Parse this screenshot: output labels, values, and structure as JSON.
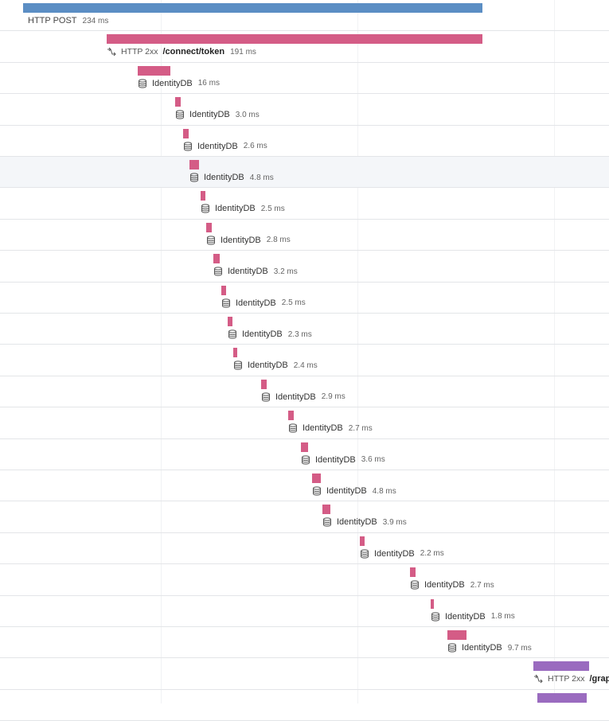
{
  "colors": {
    "root_bar": "#5b8ec4",
    "db_bar": "#d45c86",
    "http_bar": "#d45c86",
    "graph_bar": "#9a6bbf"
  },
  "spans": [
    {
      "kind": "",
      "name": "HTTP POST",
      "duration": "234 ms",
      "icon": "none",
      "color": "#5b8ec4",
      "bold": false
    },
    {
      "kind": "HTTP 2xx",
      "name": "/connect/token",
      "duration": "191 ms",
      "icon": "http-arrow-icon",
      "color": "#d45c86",
      "bold": true
    },
    {
      "kind": "",
      "name": "IdentityDB",
      "duration": "16 ms",
      "icon": "database-icon",
      "color": "#d45c86",
      "bold": false
    },
    {
      "kind": "",
      "name": "IdentityDB",
      "duration": "3.0 ms",
      "icon": "database-icon",
      "color": "#d45c86",
      "bold": false
    },
    {
      "kind": "",
      "name": "IdentityDB",
      "duration": "2.6 ms",
      "icon": "database-icon",
      "color": "#d45c86",
      "bold": false
    },
    {
      "kind": "",
      "name": "IdentityDB",
      "duration": "4.8 ms",
      "icon": "database-icon",
      "color": "#d45c86",
      "bold": false
    },
    {
      "kind": "",
      "name": "IdentityDB",
      "duration": "2.5 ms",
      "icon": "database-icon",
      "color": "#d45c86",
      "bold": false
    },
    {
      "kind": "",
      "name": "IdentityDB",
      "duration": "2.8 ms",
      "icon": "database-icon",
      "color": "#d45c86",
      "bold": false
    },
    {
      "kind": "",
      "name": "IdentityDB",
      "duration": "3.2 ms",
      "icon": "database-icon",
      "color": "#d45c86",
      "bold": false
    },
    {
      "kind": "",
      "name": "IdentityDB",
      "duration": "2.5 ms",
      "icon": "database-icon",
      "color": "#d45c86",
      "bold": false
    },
    {
      "kind": "",
      "name": "IdentityDB",
      "duration": "2.3 ms",
      "icon": "database-icon",
      "color": "#d45c86",
      "bold": false
    },
    {
      "kind": "",
      "name": "IdentityDB",
      "duration": "2.4 ms",
      "icon": "database-icon",
      "color": "#d45c86",
      "bold": false
    },
    {
      "kind": "",
      "name": "IdentityDB",
      "duration": "2.9 ms",
      "icon": "database-icon",
      "color": "#d45c86",
      "bold": false
    },
    {
      "kind": "",
      "name": "IdentityDB",
      "duration": "2.7 ms",
      "icon": "database-icon",
      "color": "#d45c86",
      "bold": false
    },
    {
      "kind": "",
      "name": "IdentityDB",
      "duration": "3.6 ms",
      "icon": "database-icon",
      "color": "#d45c86",
      "bold": false
    },
    {
      "kind": "",
      "name": "IdentityDB",
      "duration": "4.8 ms",
      "icon": "database-icon",
      "color": "#d45c86",
      "bold": false
    },
    {
      "kind": "",
      "name": "IdentityDB",
      "duration": "3.9 ms",
      "icon": "database-icon",
      "color": "#d45c86",
      "bold": false
    },
    {
      "kind": "",
      "name": "IdentityDB",
      "duration": "2.2 ms",
      "icon": "database-icon",
      "color": "#d45c86",
      "bold": false
    },
    {
      "kind": "",
      "name": "IdentityDB",
      "duration": "2.7 ms",
      "icon": "database-icon",
      "color": "#d45c86",
      "bold": false
    },
    {
      "kind": "",
      "name": "IdentityDB",
      "duration": "1.8 ms",
      "icon": "database-icon",
      "color": "#d45c86",
      "bold": false
    },
    {
      "kind": "",
      "name": "IdentityDB",
      "duration": "9.7 ms",
      "icon": "database-icon",
      "color": "#d45c86",
      "bold": false
    },
    {
      "kind": "HTTP 2xx",
      "name": "/grap",
      "duration": "",
      "icon": "http-arrow-icon",
      "color": "#9a6bbf",
      "bold": true
    },
    {
      "kind": "",
      "name": "",
      "duration": "",
      "icon": "none",
      "color": "#9a6bbf",
      "bold": false
    }
  ]
}
